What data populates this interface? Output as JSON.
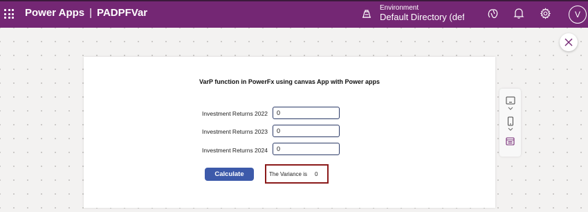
{
  "header": {
    "app_name": "Power Apps",
    "separator": "|",
    "app_title": "PADPFVar",
    "environment_label": "Environment",
    "environment_value": "Default Directory (defa...",
    "user_initial": "V",
    "bar_color": "#742774"
  },
  "icons": {
    "waffle": "waffle-icon",
    "environment": "environment-icon",
    "copilot": "copilot-icon",
    "notifications": "bell-icon",
    "settings": "gear-icon",
    "close": "close-icon",
    "tablet": "tablet-icon",
    "phone": "phone-icon",
    "web": "web-layout-icon"
  },
  "canvas": {
    "heading": "VarP function in PowerFx using canvas App with Power apps",
    "fields": [
      {
        "label": "Investment Returns 2022",
        "value": "0"
      },
      {
        "label": "Investment Returns 2023",
        "value": "0"
      },
      {
        "label": "Investment Returns 2024",
        "value": "0"
      }
    ],
    "calculate_label": "Calculate",
    "result_label": "The Variance is",
    "result_value": "0",
    "button_color": "#3d5aaa",
    "result_border_color": "#8b1a1a"
  }
}
